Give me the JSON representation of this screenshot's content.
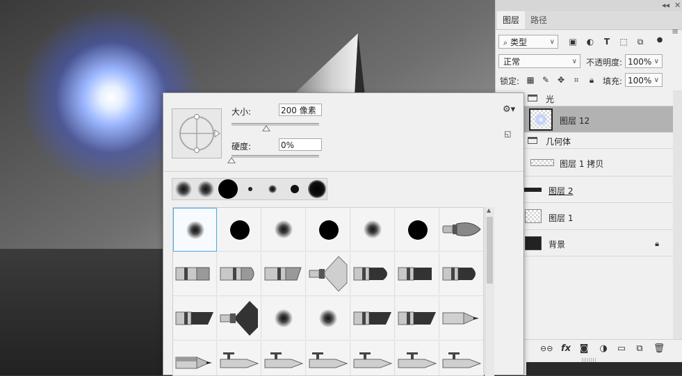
{
  "panel": {
    "tabs": [
      {
        "label": "图层"
      },
      {
        "label": "路径"
      }
    ],
    "filter_kind": "类型",
    "blend_mode": "正常",
    "opacity_label": "不透明度:",
    "opacity_value": "100%",
    "lock_label": "锁定:",
    "fill_label": "填充:",
    "fill_value": "100%"
  },
  "layers": [
    {
      "name": "光",
      "kind": "group"
    },
    {
      "name": "图层 12",
      "kind": "layer",
      "selected": true
    },
    {
      "name": "几何体",
      "kind": "group"
    },
    {
      "name": "图层 1 拷贝",
      "kind": "layer"
    },
    {
      "name": "图层 2",
      "kind": "layer"
    },
    {
      "name": "图层 1",
      "kind": "layer"
    },
    {
      "name": "背景",
      "kind": "background",
      "locked": true
    }
  ],
  "brush": {
    "size_label": "大小:",
    "size_value": "200 像素",
    "size_fraction": 0.4,
    "hardness_label": "硬度:",
    "hardness_value": "0%",
    "hardness_fraction": 0.0
  },
  "icons": {
    "search": "search-icon",
    "gear": "gear-icon",
    "lock": "lock-icon",
    "folder": "folder-icon"
  },
  "colors": {
    "selection_blue": "#4aa8e8",
    "selected_layer": "#b2b2b2"
  }
}
